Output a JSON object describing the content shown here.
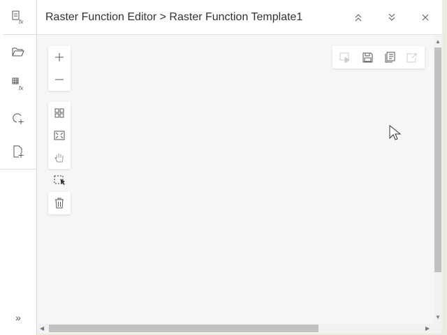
{
  "header": {
    "title": "Raster Function Editor > Raster Function Template1"
  },
  "rail": {
    "items": [
      "raster-function-templates",
      "open",
      "raster-functions",
      "add-variable",
      "new-template"
    ],
    "expand_label": "»"
  }
}
